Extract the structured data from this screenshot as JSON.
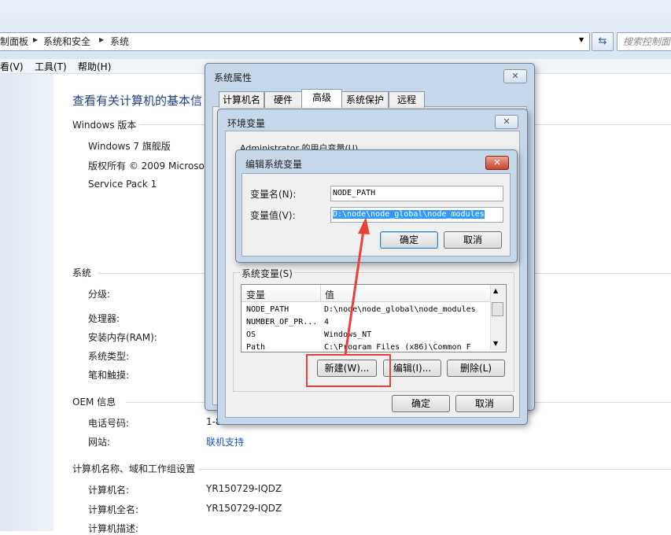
{
  "breadcrumb": [
    "制面板",
    "系统和安全",
    "系统"
  ],
  "search": {
    "placeholder": "搜索控制面"
  },
  "menubar": [
    "看(V)",
    "工具(T)",
    "帮助(H)"
  ],
  "main": {
    "title": "查看有关计算机的基本信",
    "windows_edition": {
      "heading": "Windows 版本",
      "edition": "Windows 7 旗舰版",
      "copyright": "版权所有 © 2009 Microso",
      "service_pack": "Service Pack 1"
    },
    "system": {
      "heading": "系统",
      "rating": "分级:",
      "processor": "处理器:",
      "ram": "安装内存(RAM):",
      "type": "系统类型:",
      "pen": "笔和触摸:"
    },
    "oem": {
      "heading": "OEM 信息",
      "phone_label": "电话号码:",
      "phone_value": "1-8",
      "website_label": "网站:",
      "website_link": "联机支持"
    },
    "computer": {
      "heading": "计算机名称、域和工作组设置",
      "name_label": "计算机名:",
      "name_value": "YR150729-IQDZ",
      "fullname_label": "计算机全名:",
      "fullname_value": "YR150729-IQDZ",
      "desc_label": "计算机描述:"
    }
  },
  "sysprops": {
    "title": "系统属性",
    "tabs": [
      "计算机名",
      "硬件",
      "高级",
      "系统保护",
      "远程"
    ]
  },
  "envvars": {
    "title": "环境变量",
    "user_vars_label": "Administrator 的用户变量(U)",
    "sys_vars_label": "系统变量(S)",
    "columns": [
      "变量",
      "值"
    ],
    "rows": [
      {
        "name": "NODE_PATH",
        "value": "D:\\node\\node_global\\node_modules"
      },
      {
        "name": "NUMBER_OF_PR...",
        "value": "4"
      },
      {
        "name": "OS",
        "value": "Windows_NT"
      },
      {
        "name": "Path",
        "value": "C:\\Program Files (x86)\\Common F"
      }
    ],
    "buttons": {
      "new": "新建(W)...",
      "edit": "编辑(I)...",
      "delete": "删除(L)",
      "ok": "确定",
      "cancel": "取消"
    }
  },
  "edit_dialog": {
    "title": "编辑系统变量",
    "name_label": "变量名(N):",
    "name_value": "NODE_PATH",
    "value_label": "变量值(V):",
    "value_value": "D:\\node\\node_global\\node_modules",
    "ok": "确定",
    "cancel": "取消"
  },
  "annotation": {
    "color": "#e8413a"
  }
}
